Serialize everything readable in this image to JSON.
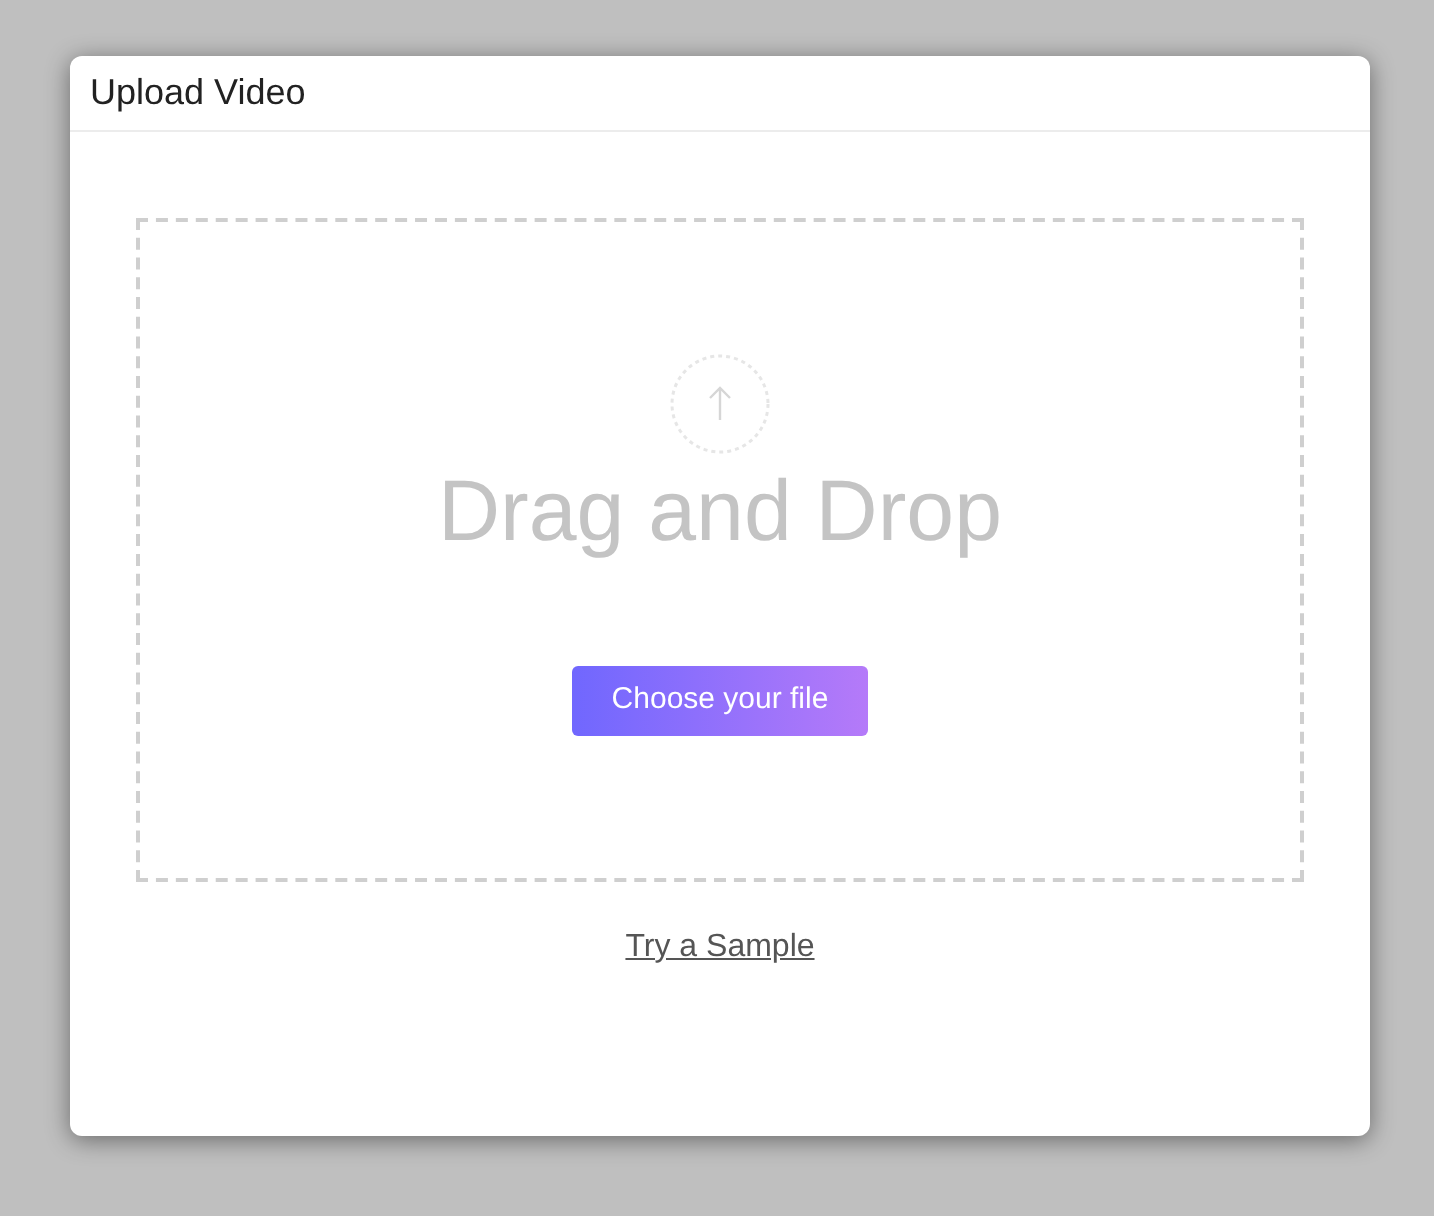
{
  "dialog": {
    "title": "Upload Video"
  },
  "dropzone": {
    "heading": "Drag and Drop",
    "button": "Choose your file"
  },
  "link": "Try a Sample"
}
